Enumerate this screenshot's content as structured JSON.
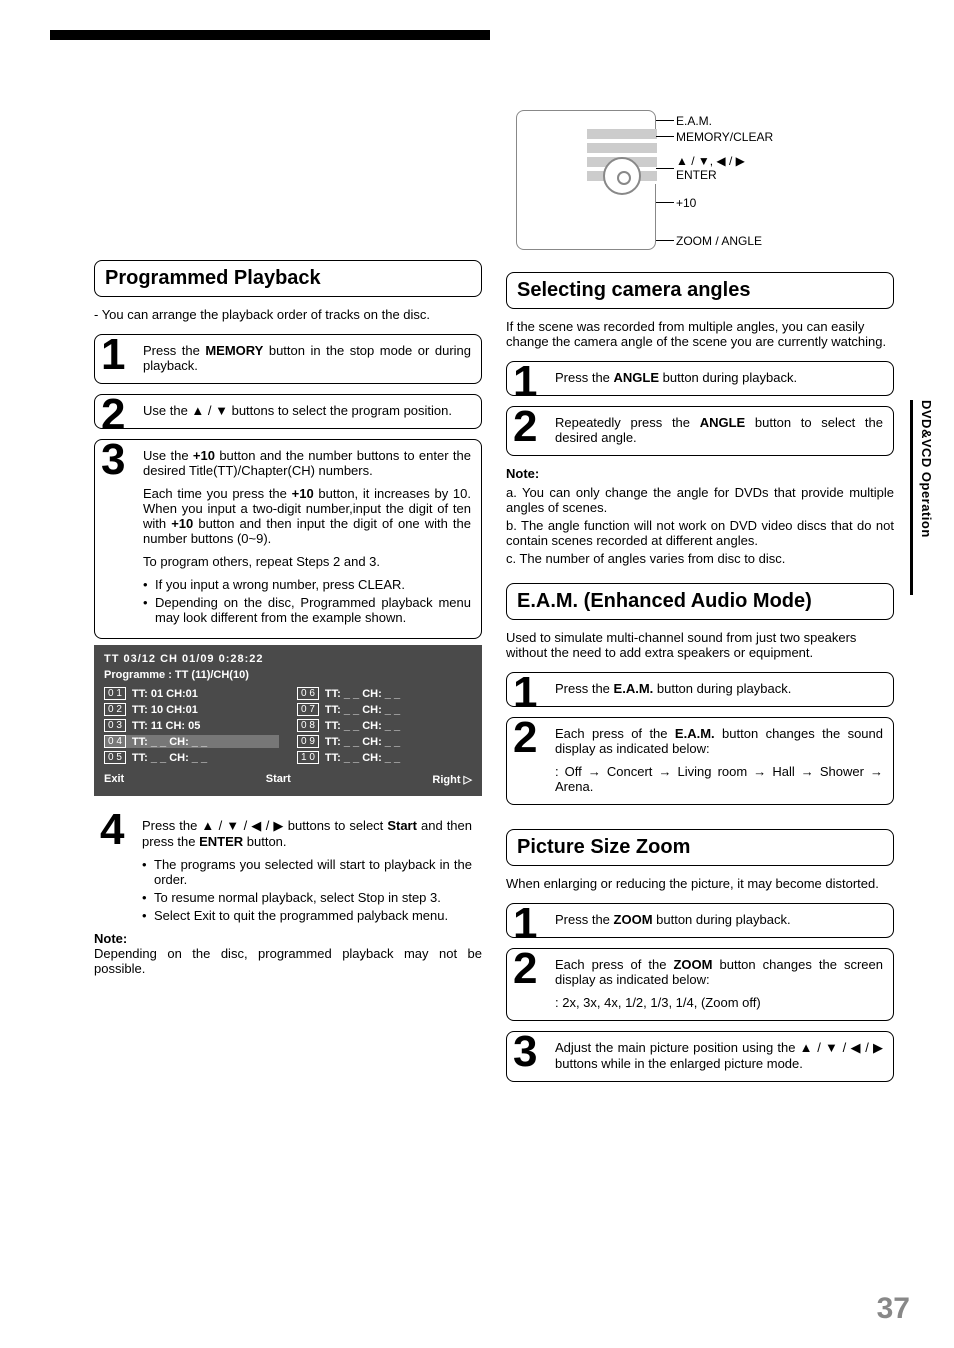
{
  "page_number": "37",
  "side_tab": "DVD&VCD Operation",
  "remote": {
    "labels": [
      "E.A.M.",
      "MEMORY/CLEAR",
      "▲ / ▼, ◀ / ▶\nENTER",
      "+10",
      "ZOOM / ANGLE"
    ]
  },
  "left": {
    "title": "Programmed Playback",
    "intro": "-  You can arrange the playback order of tracks on the disc.",
    "step1_a": "Press the ",
    "step1_b": "MEMORY",
    "step1_c": " button in the stop mode or during playback.",
    "step2": "Use the ▲ / ▼ buttons to select the program position.",
    "step3_a": "Use the ",
    "step3_b": "+10",
    "step3_c": " button and the number buttons to enter the desired Title(TT)/Chapter(CH) numbers.",
    "step3_p1_a": "Each time you press the ",
    "step3_p1_b": "+10",
    "step3_p1_c": " button, it increases by 10. When you input a two-digit number,input the digit of ten with ",
    "step3_p1_d": "+10",
    "step3_p1_e": " button and then input the digit of one with the number buttons (0~9).",
    "step3_p2": "To program others, repeat Steps 2 and 3.",
    "step3_bullets": [
      "If you input a wrong number, press CLEAR.",
      "Depending on the disc, Programmed playback menu may look different from the example shown."
    ],
    "osd": {
      "top": "TT   03/12    CH   01/09          0:28:22",
      "sub": "Programme : TT (11)/CH(10)",
      "footer": [
        "Exit",
        "Start",
        "Right ▷"
      ],
      "leftcol": [
        {
          "idx": "0 1",
          "txt": "TT: 01    CH:01"
        },
        {
          "idx": "0 2",
          "txt": "TT: 10    CH:01"
        },
        {
          "idx": "0 3",
          "txt": "TT: 11    CH: 05"
        },
        {
          "idx": "0 4",
          "txt": "TT: _ _    CH: _ _",
          "hl": true
        },
        {
          "idx": "0 5",
          "txt": "TT: _ _    CH: _ _"
        }
      ],
      "rightcol": [
        {
          "idx": "0 6",
          "txt": "TT: _ _    CH: _ _"
        },
        {
          "idx": "0 7",
          "txt": "TT: _ _    CH: _ _"
        },
        {
          "idx": "0 8",
          "txt": "TT: _ _    CH: _ _"
        },
        {
          "idx": "0 9",
          "txt": "TT: _ _    CH: _ _"
        },
        {
          "idx": "1 0",
          "txt": "TT: _ _    CH: _ _"
        }
      ]
    },
    "step4_a": "Press the ▲ / ▼ / ◀ / ▶ buttons to select ",
    "step4_b": "Start",
    "step4_c": " and then press the ",
    "step4_d": "ENTER",
    "step4_e": " button.",
    "step4_bullets": [
      "The programs you selected will start to playback in the order.",
      "To resume normal playback, select Stop in step 3.",
      "Select Exit to quit the programmed palyback menu."
    ],
    "note_h": "Note:",
    "note_body": "Depending on the disc, programmed playback may not be possible."
  },
  "right": {
    "angles": {
      "title": "Selecting camera angles",
      "intro": "If the scene was recorded from multiple angles, you can easily change the camera angle of the scene you are currently watching.",
      "step1_a": "Press the ",
      "step1_b": "ANGLE",
      "step1_c": " button during playback.",
      "step2_a": "Repeatedly press the ",
      "step2_b": "ANGLE",
      "step2_c": " button to select the desired angle.",
      "note_h": "Note:",
      "notes": [
        "a. You can only change the angle for DVDs that provide multiple angles of scenes.",
        "b. The angle function will not work on DVD video discs that do not contain scenes recorded at different angles.",
        "c. The number of angles varies from disc to disc."
      ]
    },
    "eam": {
      "title": "E.A.M. (Enhanced Audio Mode)",
      "intro": "Used to simulate multi-channel sound from just two speakers without the need to add extra speakers or equipment.",
      "step1_a": "Press the ",
      "step1_b": "E.A.M.",
      "step1_c": " button during playback.",
      "step2_a": "Each press of the ",
      "step2_b": "E.A.M.",
      "step2_c": " button changes the sound display as indicated below:",
      "step2_seq": ": Off → Concert → Living room → Hall → Shower → Arena."
    },
    "zoom": {
      "title": "Picture Size Zoom",
      "intro": "When enlarging or reducing the picture, it may become distorted.",
      "step1_a": "Press the ",
      "step1_b": "ZOOM",
      "step1_c": " button during playback.",
      "step2_a": "Each press of the ",
      "step2_b": "ZOOM",
      "step2_c": " button changes the screen display as indicated below:",
      "step2_seq": ": 2x, 3x, 4x, 1/2, 1/3, 1/4, (Zoom off)",
      "step3": "Adjust the main picture position using the ▲ / ▼ / ◀ / ▶ buttons while in the enlarged picture mode."
    }
  }
}
